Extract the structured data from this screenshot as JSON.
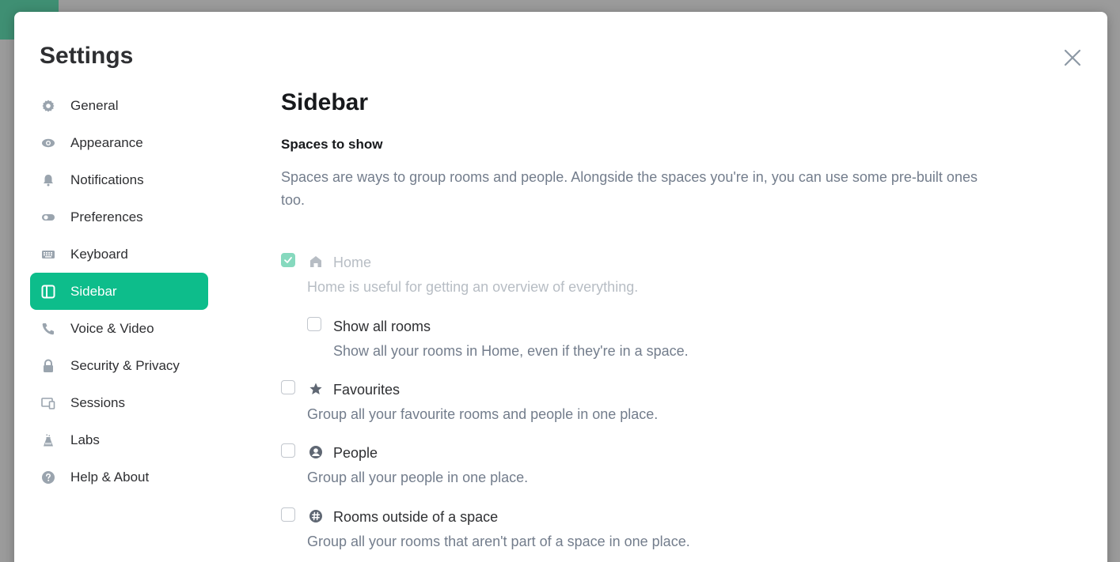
{
  "dialog": {
    "title": "Settings"
  },
  "nav": {
    "items": [
      {
        "label": "General",
        "icon": "gear-icon",
        "active": false
      },
      {
        "label": "Appearance",
        "icon": "eye-icon",
        "active": false
      },
      {
        "label": "Notifications",
        "icon": "bell-icon",
        "active": false
      },
      {
        "label": "Preferences",
        "icon": "toggle-icon",
        "active": false
      },
      {
        "label": "Keyboard",
        "icon": "keyboard-icon",
        "active": false
      },
      {
        "label": "Sidebar",
        "icon": "sidebar-icon",
        "active": true
      },
      {
        "label": "Voice & Video",
        "icon": "phone-icon",
        "active": false
      },
      {
        "label": "Security & Privacy",
        "icon": "lock-icon",
        "active": false
      },
      {
        "label": "Sessions",
        "icon": "devices-icon",
        "active": false
      },
      {
        "label": "Labs",
        "icon": "flask-icon",
        "active": false
      },
      {
        "label": "Help & About",
        "icon": "help-icon",
        "active": false
      }
    ]
  },
  "content": {
    "heading": "Sidebar",
    "subheading": "Spaces to show",
    "description": "Spaces are ways to group rooms and people. Alongside the spaces you're in, you can use some pre-built ones too.",
    "options": {
      "home": {
        "label": "Home",
        "description": "Home is useful for getting an overview of everything.",
        "checked": true,
        "disabled": true,
        "icon": "home-icon"
      },
      "show_all_rooms": {
        "label": "Show all rooms",
        "description": "Show all your rooms in Home, even if they're in a space.",
        "checked": false
      },
      "favourites": {
        "label": "Favourites",
        "description": "Group all your favourite rooms and people in one place.",
        "checked": false,
        "icon": "star-icon"
      },
      "people": {
        "label": "People",
        "description": "Group all your people in one place.",
        "checked": false,
        "icon": "person-icon"
      },
      "rooms_outside": {
        "label": "Rooms outside of a space",
        "description": "Group all your rooms that aren't part of a space in one place.",
        "checked": false,
        "icon": "hash-icon"
      }
    }
  },
  "colors": {
    "accent": "#0dbd8b",
    "checkbox_checked_disabled": "#86d9be",
    "text_primary": "#2e2f32",
    "text_secondary": "#737d8c",
    "icon_gray": "#8d99a5"
  }
}
